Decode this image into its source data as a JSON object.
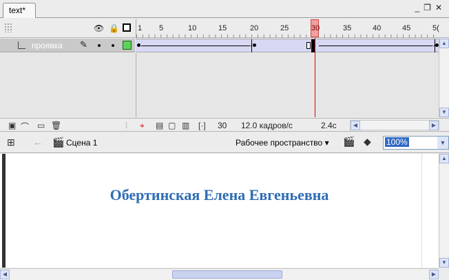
{
  "document_tab": {
    "label": "text*"
  },
  "window_controls": {
    "minimize": "_",
    "restore": "❐",
    "close": "✕"
  },
  "timeline": {
    "header_icons": [
      "eye-icon",
      "lock-icon",
      "outline-icon"
    ],
    "ruler_numbers": [
      "1",
      "5",
      "10",
      "15",
      "20",
      "25",
      "30",
      "35",
      "40",
      "45",
      "5("
    ],
    "current_frame": "30",
    "layer": {
      "name": "проявка",
      "icon": "layer-icon"
    },
    "footer": {
      "frame": "30",
      "fps": "12.0 кадров/с",
      "time": "2.4с"
    }
  },
  "editbar": {
    "scene": "Сцена 1",
    "workspace": "Рабочее пространство",
    "zoom": "100%"
  },
  "stage": {
    "text": "Обертинская Елена Евгеньевна",
    "text_color": "#2e6db4"
  }
}
